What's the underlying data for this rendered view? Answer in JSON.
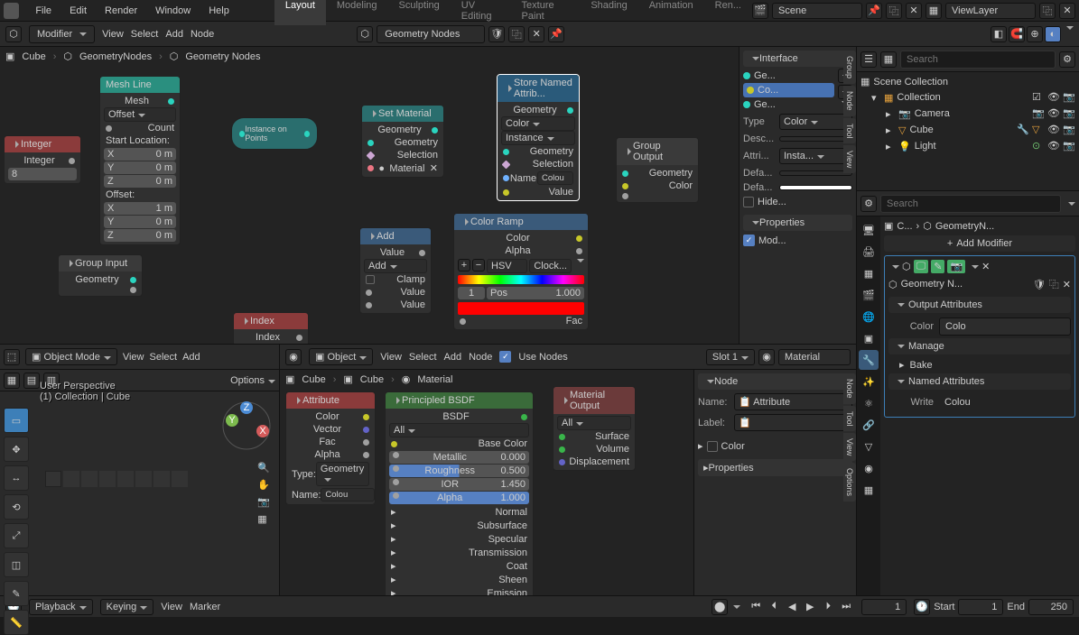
{
  "topmenu": {
    "file": "File",
    "edit": "Edit",
    "render": "Render",
    "window": "Window",
    "help": "Help"
  },
  "workspaces": [
    "Layout",
    "Modeling",
    "Sculpting",
    "UV Editing",
    "Texture Paint",
    "Shading",
    "Animation",
    "Ren..."
  ],
  "active_workspace": 0,
  "scene_field": "Scene",
  "viewlayer_field": "ViewLayer",
  "geo_editor": {
    "header": {
      "mode": "Modifier",
      "view": "View",
      "select": "Select",
      "add": "Add",
      "node": "Node",
      "tree": "Geometry Nodes"
    },
    "breadcrumb": [
      "Cube",
      "GeometryNodes",
      "Geometry Nodes"
    ],
    "nodes": {
      "integer": {
        "title": "Integer",
        "label": "Integer",
        "value": "8"
      },
      "mesh_line": {
        "title": "Mesh Line",
        "out": "Mesh",
        "mode": "Offset",
        "count": "Count",
        "start": "Start Location:",
        "offset": "Offset:",
        "x": "X",
        "y": "Y",
        "z": "Z",
        "xv": "0 m",
        "yv": "0 m",
        "zv": "0 m",
        "xov": "1 m",
        "yov": "0 m",
        "zov": "0 m"
      },
      "group_input": {
        "title": "Group Input",
        "geometry": "Geometry"
      },
      "instance": {
        "title": "Instance on Points"
      },
      "set_material": {
        "title": "Set Material",
        "geo": "Geometry",
        "sel": "Selection",
        "mat": "Material"
      },
      "index": {
        "title": "Index",
        "out": "Index"
      },
      "add": {
        "title": "Add",
        "mode": "Add",
        "clamp": "Clamp",
        "value": "Value"
      },
      "store": {
        "title": "Store Named Attrib...",
        "geo": "Geometry",
        "domain": "Instance",
        "dtype": "Color",
        "sel": "Selection",
        "name": "Name",
        "name_val": "Colou",
        "value": "Value"
      },
      "ramp": {
        "title": "Color Ramp",
        "color": "Color",
        "alpha": "Alpha",
        "fac": "Fac",
        "pos": "Pos",
        "posv": "1.000",
        "idx": "1",
        "hsv": "HSV",
        "clock": "Clock..."
      },
      "group_output": {
        "title": "Group Output",
        "geo": "Geometry",
        "col": "Color"
      }
    },
    "sidepanel": {
      "interface": "Interface",
      "items": [
        "Ge...",
        "Co...",
        "Ge..."
      ],
      "type_l": "Type",
      "type_v": "Color",
      "desc": "Desc...",
      "attr": "Attri...",
      "attr_v": "Insta...",
      "def1": "Defa...",
      "def2": "Defa...",
      "hide": "Hide...",
      "props": "Properties",
      "mod": "Mod..."
    }
  },
  "viewport": {
    "mode": "Object Mode",
    "view": "View",
    "select": "Select",
    "add": "Add",
    "options": "Options",
    "info1": "User Perspective",
    "info2": "(1) Collection | Cube"
  },
  "shader": {
    "type": "Object",
    "view": "View",
    "select": "Select",
    "add": "Add",
    "node": "Node",
    "use_nodes": "Use Nodes",
    "slot": "Slot 1",
    "mat": "Material",
    "breadcrumb": [
      "Cube",
      "Cube",
      "Material"
    ],
    "attribute": {
      "title": "Attribute",
      "color": "Color",
      "vector": "Vector",
      "fac": "Fac",
      "alpha": "Alpha",
      "type_l": "Type:",
      "type_v": "Geometry",
      "name_l": "Name:",
      "name_v": "Colou"
    },
    "principled": {
      "title": "Principled BSDF",
      "bsdf": "BSDF",
      "all": "All",
      "base": "Base Color",
      "metallic": "Metallic",
      "metallic_v": "0.000",
      "rough": "Roughness",
      "rough_v": "0.500",
      "ior": "IOR",
      "ior_v": "1.450",
      "alpha": "Alpha",
      "alpha_v": "1.000",
      "sections": [
        "Normal",
        "Subsurface",
        "Specular",
        "Transmission",
        "Coat",
        "Sheen",
        "Emission"
      ]
    },
    "output": {
      "title": "Material Output",
      "all": "All",
      "surface": "Surface",
      "volume": "Volume",
      "disp": "Displacement"
    },
    "sidepanel": {
      "node": "Node",
      "name_l": "Name:",
      "name_v": "Attribute",
      "label_l": "Label:",
      "color": "Color",
      "props": "Properties"
    }
  },
  "outliner": {
    "search": "Search",
    "root": "Scene Collection",
    "collection": "Collection",
    "items": [
      {
        "name": "Camera",
        "icon": "camera"
      },
      {
        "name": "Cube",
        "icon": "mesh"
      },
      {
        "name": "Light",
        "icon": "light"
      }
    ]
  },
  "props_panel": {
    "search": "Search",
    "crumb": [
      "C...",
      "GeometryN..."
    ],
    "add_mod": "Add Modifier",
    "mod_name": "Geometry N...",
    "sections": {
      "out_attr": "Output Attributes",
      "color_l": "Color",
      "color_v": "Colo",
      "manage": "Manage",
      "bake": "Bake",
      "named": "Named Attributes",
      "write": "Write",
      "write_v": "Colou"
    }
  },
  "timeline": {
    "playback": "Playback",
    "keying": "Keying",
    "view": "View",
    "marker": "Marker",
    "frame": "1",
    "start_l": "Start",
    "start_v": "1",
    "end_l": "End",
    "end_v": "250"
  }
}
